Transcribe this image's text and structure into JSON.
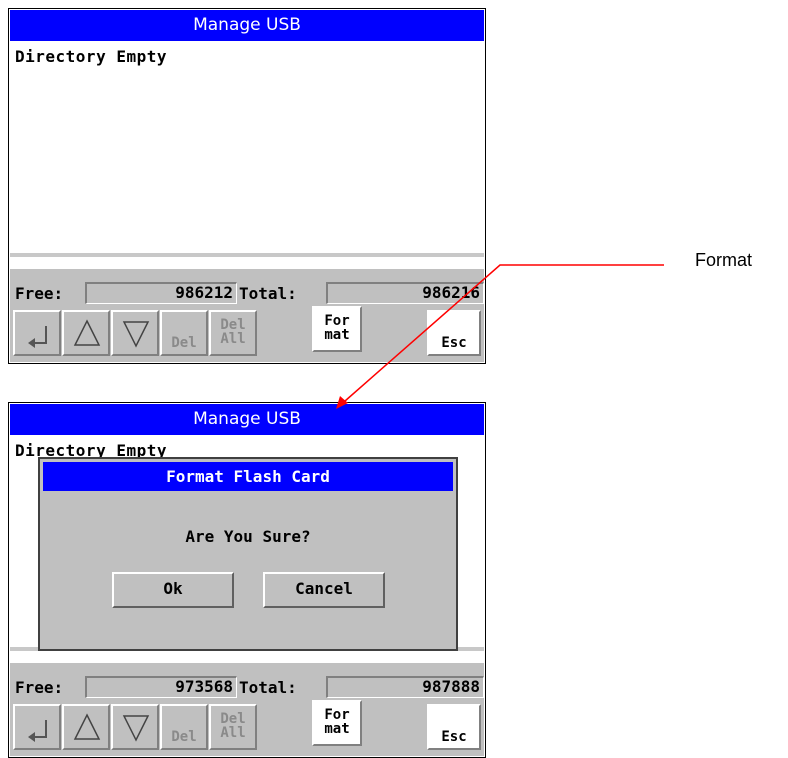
{
  "caption": "Format",
  "colors": {
    "titlebar": "#0000ff",
    "panel": "#c0c0c0",
    "arrow": "#ff0000"
  },
  "screen1": {
    "title": "Manage USB",
    "message": "Directory Empty",
    "free_label": "Free:",
    "free_value": "986212",
    "total_label": "Total:",
    "total_value": "986216",
    "buttons": [
      {
        "name": "enter",
        "icon": "enter-arrow-icon",
        "label": ""
      },
      {
        "name": "up",
        "icon": "up-triangle-icon",
        "label": ""
      },
      {
        "name": "down",
        "icon": "down-triangle-icon",
        "label": ""
      },
      {
        "name": "del",
        "label": "Del"
      },
      {
        "name": "del-all",
        "label_line1": "Del",
        "label_line2": "All"
      },
      {
        "name": "format",
        "label_line1": "For",
        "label_line2": "mat"
      },
      {
        "name": "esc",
        "label": "Esc"
      }
    ]
  },
  "screen2": {
    "title": "Manage USB",
    "message": "Directory Empty",
    "free_label": "Free:",
    "free_value": "973568",
    "total_label": "Total:",
    "total_value": "987888",
    "dialog": {
      "title": "Format Flash Card",
      "text": "Are You Sure?",
      "ok_label": "Ok",
      "cancel_label": "Cancel"
    }
  }
}
